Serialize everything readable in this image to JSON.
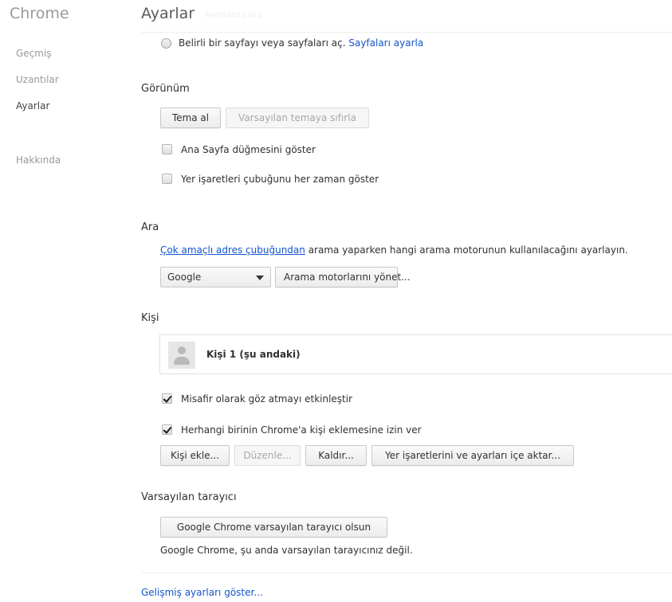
{
  "app": {
    "brand": "Chrome"
  },
  "nav": {
    "items": [
      {
        "label": "Geçmiş"
      },
      {
        "label": "Uzantılar"
      },
      {
        "label": "Ayarlar"
      },
      {
        "label": "Hakkında"
      }
    ]
  },
  "header": {
    "title": "Ayarlar",
    "search_placeholder": "Ayarlarda ara"
  },
  "startup": {
    "radio_label": "Belirli bir sayfayı veya sayfaları aç.",
    "link": "Sayfaları ayarla"
  },
  "appearance": {
    "title": "Görünüm",
    "get_theme": "Tema al",
    "reset_theme": "Varsayılan temaya sıfırla",
    "show_home": "Ana Sayfa düğmesini göster",
    "show_bookmarks": "Yer işaretleri çubuğunu her zaman göster"
  },
  "search": {
    "title": "Ara",
    "link": "Çok amaçlı adres çubuğundan",
    "desc": " arama yaparken hangi arama motorunun kullanılacağını ayarlayın.",
    "engine": "Google",
    "manage": "Arama motorlarını yönet..."
  },
  "people": {
    "title": "Kişi",
    "profile_name": "Kişi 1 (şu andaki)",
    "guest": "Misafir olarak göz atmayı etkinleştir",
    "add_anyone": "Herhangi birinin Chrome'a kişi eklemesine izin ver",
    "btn_add": "Kişi ekle...",
    "btn_edit": "Düzenle...",
    "btn_remove": "Kaldır...",
    "btn_import": "Yer işaretlerini ve ayarları içe aktar..."
  },
  "default_browser": {
    "title": "Varsayılan tarayıcı",
    "button": "Google Chrome varsayılan tarayıcı olsun",
    "status": "Google Chrome, şu anda varsayılan tarayıcınız değil."
  },
  "footer": {
    "advanced_link": "Gelişmiş ayarları göster..."
  }
}
